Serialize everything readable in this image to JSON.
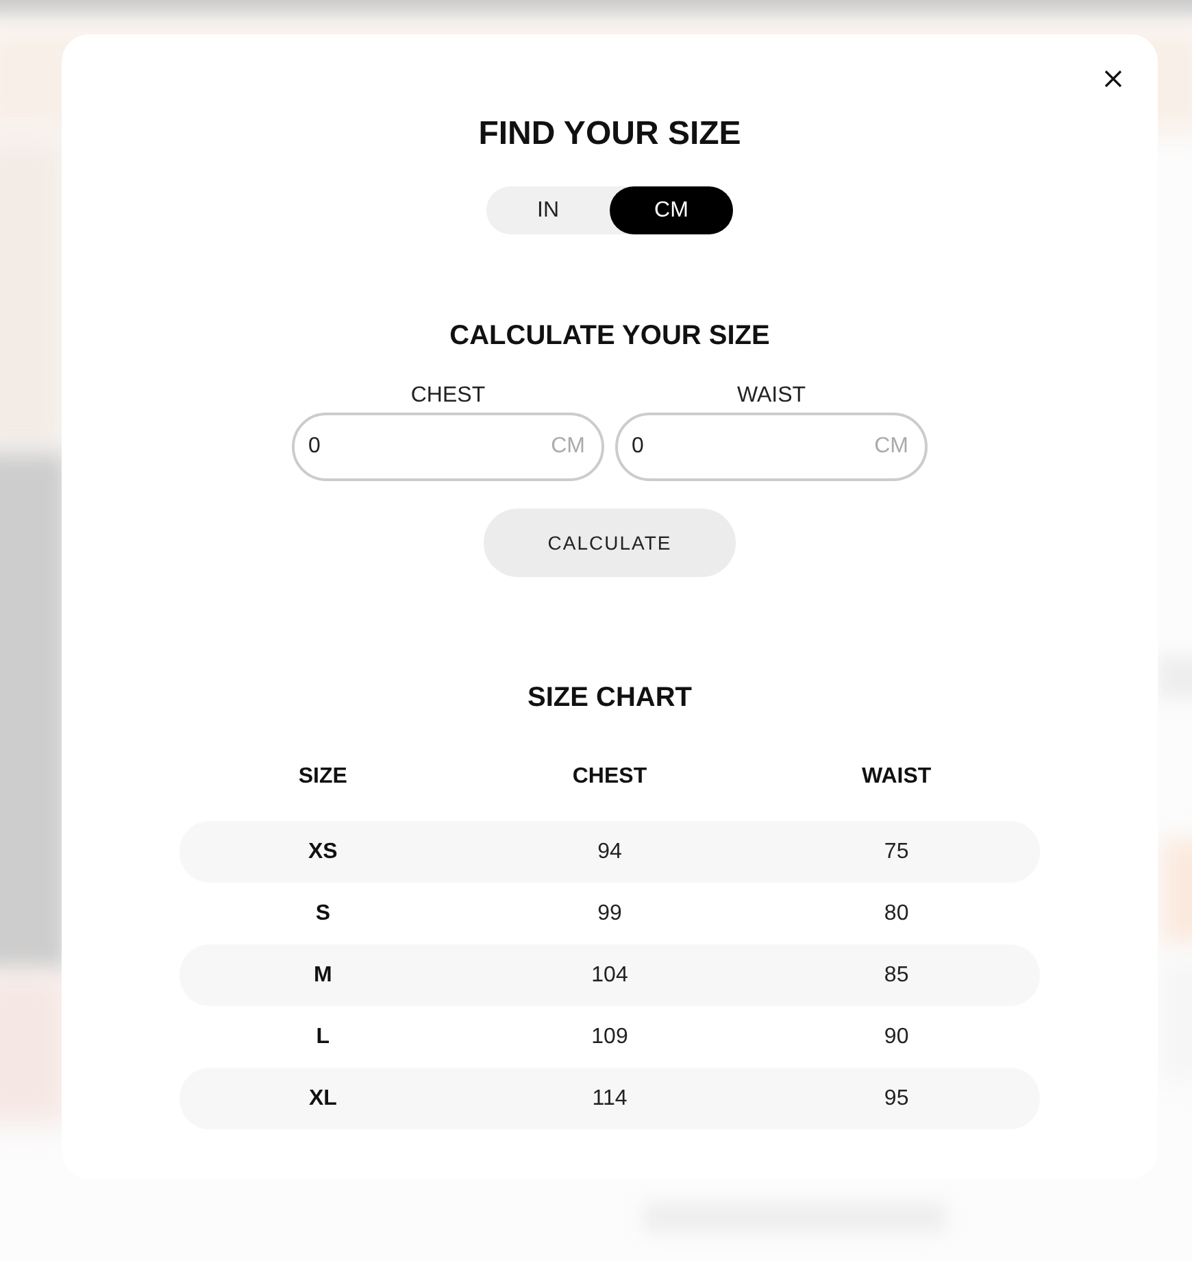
{
  "dialog": {
    "title": "FIND YOUR SIZE"
  },
  "unit_toggle": [
    {
      "label": "IN",
      "selected": false
    },
    {
      "label": "CM",
      "selected": true
    }
  ],
  "calculator": {
    "title": "CALCULATE YOUR SIZE",
    "fields": [
      {
        "label": "CHEST",
        "value": "0",
        "unit": "CM"
      },
      {
        "label": "WAIST",
        "value": "0",
        "unit": "CM"
      }
    ],
    "button": "CALCULATE"
  },
  "size_chart": {
    "title": "SIZE CHART",
    "columns": [
      "SIZE",
      "CHEST",
      "WAIST"
    ],
    "rows": [
      [
        "XS",
        "94",
        "75"
      ],
      [
        "S",
        "99",
        "80"
      ],
      [
        "M",
        "104",
        "85"
      ],
      [
        "L",
        "109",
        "90"
      ],
      [
        "XL",
        "114",
        "95"
      ]
    ]
  }
}
